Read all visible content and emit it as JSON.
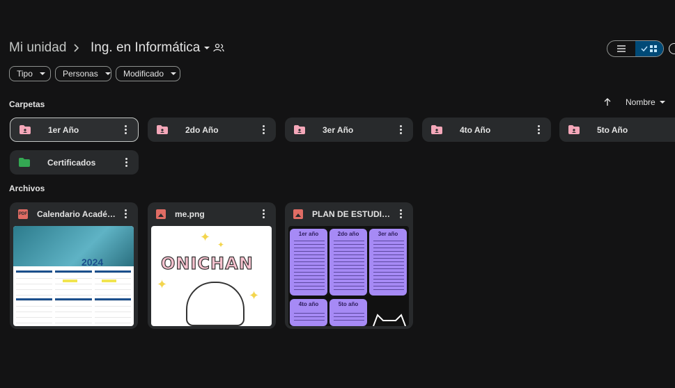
{
  "breadcrumb": {
    "root": "Mi unidad",
    "current": "Ing. en Informática"
  },
  "filters": [
    "Tipo",
    "Personas",
    "Modificado"
  ],
  "sections": {
    "folders": "Carpetas",
    "files": "Archivos"
  },
  "sort": {
    "label": "Nombre"
  },
  "folders": [
    {
      "name": "1er Año",
      "color": "#f4a7b9"
    },
    {
      "name": "2do Año",
      "color": "#f4a7b9"
    },
    {
      "name": "3er Año",
      "color": "#f4a7b9"
    },
    {
      "name": "4to Año",
      "color": "#f4a7b9"
    },
    {
      "name": "5to Año",
      "color": "#f4a7b9"
    },
    {
      "name": "Certificados",
      "color": "#34a853"
    }
  ],
  "files": [
    {
      "name": "Calendario Académic...",
      "type_icon": "pdf-icon",
      "thumb_text": "2024"
    },
    {
      "name": "me.png",
      "type_icon": "image-icon",
      "thumb_text": "ONICHAN"
    },
    {
      "name": "PLAN DE ESTUDIOS.p...",
      "type_icon": "image-icon",
      "thumb_cols": [
        "1er año",
        "2do año",
        "3er año",
        "4to año",
        "5to año"
      ]
    }
  ],
  "colors": {
    "background": "#131314",
    "card": "#282a2c",
    "accent": "#004a77"
  }
}
